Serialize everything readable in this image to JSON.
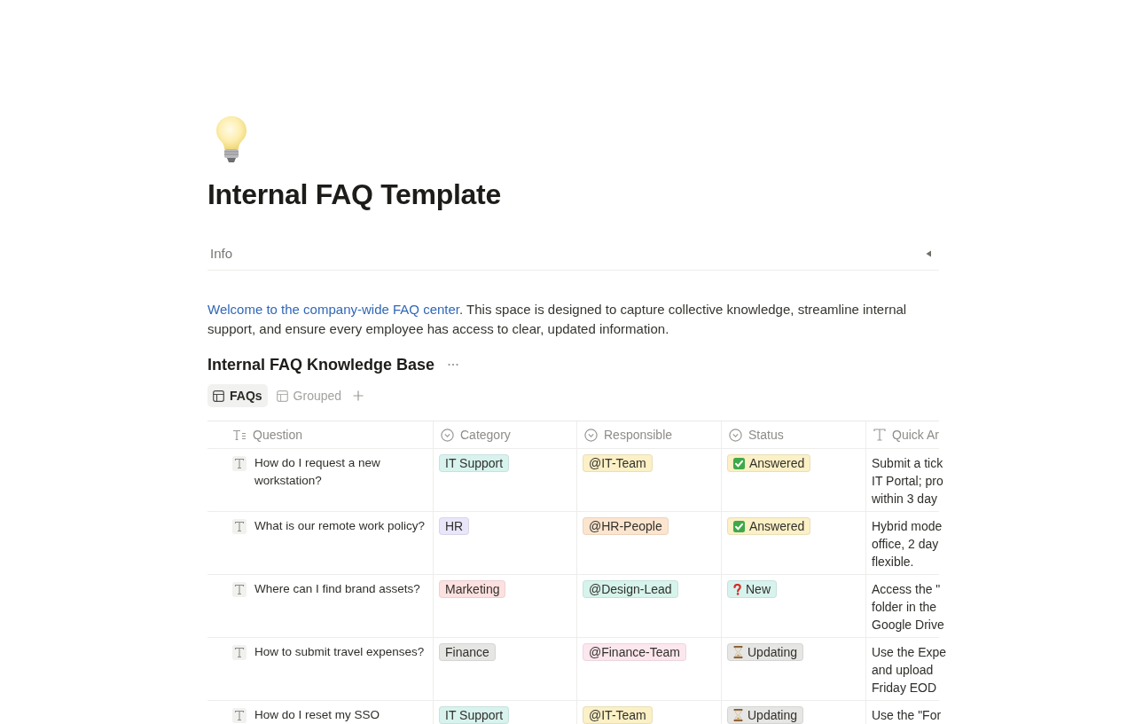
{
  "page": {
    "title": "Internal FAQ Template"
  },
  "info": {
    "label": "Info",
    "expanded": false
  },
  "intro": {
    "link": "Welcome to the company-wide FAQ center",
    "text": ". This space is designed to capture collective knowledge, streamline internal support, and ensure every employee has access to clear, updated information."
  },
  "database": {
    "title": "Internal FAQ Knowledge Base",
    "views": [
      {
        "label": "FAQs",
        "selected": true
      },
      {
        "label": "Grouped",
        "selected": false
      }
    ],
    "columns": [
      {
        "label": "Question",
        "kind": "title"
      },
      {
        "label": "Category",
        "kind": "select"
      },
      {
        "label": "Responsible",
        "kind": "select"
      },
      {
        "label": "Status",
        "kind": "select"
      },
      {
        "label": "Quick Ar",
        "kind": "text"
      }
    ],
    "rows": [
      {
        "question": "How do I request a new workstation?",
        "category": {
          "label": "IT Support",
          "color": "#d8f3ee"
        },
        "responsible": {
          "label": "@IT-Team",
          "color": "#fbf0c6"
        },
        "status": {
          "label": "Answered",
          "kind": "answered",
          "color": "#fbf0c6"
        },
        "quick_answer": [
          "Submit a tick",
          "IT Portal; pro",
          "within 3 day"
        ]
      },
      {
        "question": "What is our remote work policy?",
        "category": {
          "label": "HR",
          "color": "#e9e6fa"
        },
        "responsible": {
          "label": "@HR-People",
          "color": "#fce5cf"
        },
        "status": {
          "label": "Answered",
          "kind": "answered",
          "color": "#fbf0c6"
        },
        "quick_answer": [
          "Hybrid mode",
          "office, 2 day",
          "flexible."
        ]
      },
      {
        "question": "Where can I find brand assets?",
        "category": {
          "label": "Marketing",
          "color": "#fde1e1"
        },
        "responsible": {
          "label": "@Design-Lead",
          "color": "#d6f4ec"
        },
        "status": {
          "label": "New",
          "kind": "new",
          "color": "#d8f3ee"
        },
        "quick_answer": [
          "Access the \"",
          "folder in the",
          "Google Drive"
        ]
      },
      {
        "question": "How to submit travel expenses?",
        "category": {
          "label": "Finance",
          "color": "#e6e6e4"
        },
        "responsible": {
          "label": "@Finance-Team",
          "color": "#fde7ee"
        },
        "status": {
          "label": "Updating",
          "kind": "updating",
          "color": "#e6e6e4"
        },
        "quick_answer": [
          "Use the Expe",
          "and upload",
          "Friday EOD"
        ]
      },
      {
        "question": "How do I reset my SSO",
        "category": {
          "label": "IT Support",
          "color": "#d8f3ee"
        },
        "responsible": {
          "label": "@IT-Team",
          "color": "#fbf0c6"
        },
        "status": {
          "label": "Updating",
          "kind": "updating",
          "color": "#e6e6e4"
        },
        "quick_answer": [
          "Use the \"For"
        ]
      }
    ]
  }
}
